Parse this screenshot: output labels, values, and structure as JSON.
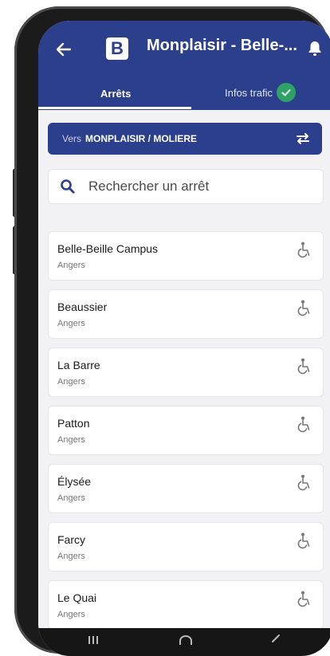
{
  "header": {
    "title": "Monplaisir - Belle-...",
    "logo_letter": "B",
    "icons": [
      "back-arrow-icon",
      "bell-icon"
    ]
  },
  "tabs": [
    {
      "label": "Arrêts",
      "active": true
    },
    {
      "label": "Infos trafic",
      "status_icon": "check-circle-icon",
      "active": false
    }
  ],
  "direction": {
    "prefix": "Vers",
    "destination": "MONPLAISIR / MOLIERE",
    "swap_icon": "swap-arrows-icon"
  },
  "search": {
    "placeholder": "Rechercher un arrêt",
    "value": ""
  },
  "stops": [
    {
      "name": "Belle-Beille Campus",
      "city": "Angers",
      "accessible": true
    },
    {
      "name": "Beaussier",
      "city": "Angers",
      "accessible": true
    },
    {
      "name": "La Barre",
      "city": "Angers",
      "accessible": true
    },
    {
      "name": "Patton",
      "city": "Angers",
      "accessible": true
    },
    {
      "name": "Élysée",
      "city": "Angers",
      "accessible": true
    },
    {
      "name": "Farcy",
      "city": "Angers",
      "accessible": true
    },
    {
      "name": "Le Quai",
      "city": "Angers",
      "accessible": true
    }
  ],
  "colors": {
    "primary": "#2c3f8d",
    "success": "#2fb55e",
    "background": "#f2f2f4"
  }
}
